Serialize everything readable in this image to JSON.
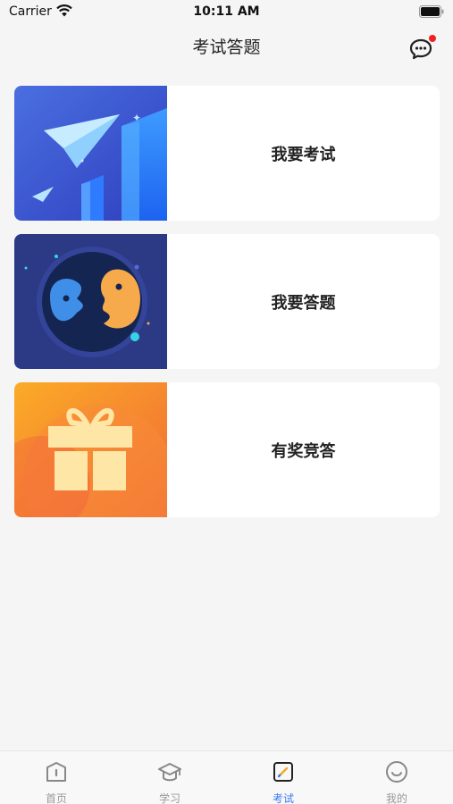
{
  "status_bar": {
    "carrier": "Carrier",
    "time": "10:11 AM"
  },
  "nav": {
    "title": "考试答题",
    "message_icon": "chat-bubble-icon",
    "has_unread": true
  },
  "cards": [
    {
      "label": "我要考试",
      "icon": "paper-plane-illustration"
    },
    {
      "label": "我要答题",
      "icon": "faces-illustration"
    },
    {
      "label": "有奖竞答",
      "icon": "gift-illustration"
    }
  ],
  "tab_bar": {
    "tabs": [
      {
        "label": "首页",
        "icon": "home-icon",
        "active": false
      },
      {
        "label": "学习",
        "icon": "graduation-cap-icon",
        "active": false
      },
      {
        "label": "考试",
        "icon": "edit-icon",
        "active": true
      },
      {
        "label": "我的",
        "icon": "smile-icon",
        "active": false
      }
    ]
  },
  "colors": {
    "accent": "#3b7bf0",
    "badge": "#ee2222",
    "background": "#f5f5f5"
  }
}
